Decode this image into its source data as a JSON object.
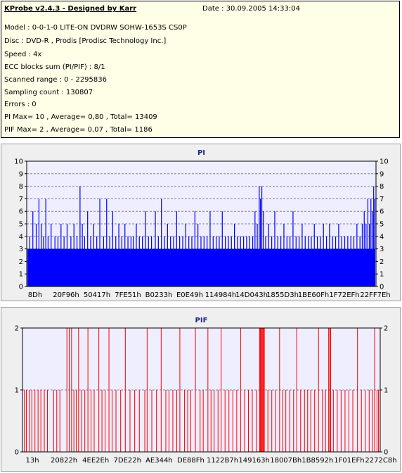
{
  "info": {
    "title": "KProbe v2.4.3 - Designed by Karr",
    "date": "Date : 30.09.2005 14:33:04",
    "lines": [
      "Model : 0-0-1-0 LITE-ON DVDRW SOHW-1653S CS0P",
      "Disc : DVD-R , Prodis [Prodisc Technology Inc.]",
      "Speed : 4x",
      "ECC blocks sum (PI/PIF) : 8/1",
      "Scanned range : 0 - 2295836",
      "Sampling count : 130807",
      "Errors : 0",
      "PI Max= 10 , Average= 0,80 , Total= 13409",
      "PIF Max= 2 , Average= 0,07 , Total= 1186"
    ]
  },
  "chart_data": [
    {
      "type": "bar",
      "title": "PI",
      "color": "#0000ff",
      "ylim": [
        0,
        10
      ],
      "yticks": [
        0,
        1,
        2,
        3,
        4,
        5,
        6,
        7,
        8,
        9,
        10
      ],
      "xlim": [
        0,
        2295836
      ],
      "xticks": [
        "8Dh",
        "20F96h",
        "50417h",
        "7FE51h",
        "B0233h",
        "E0E49h",
        "114984h",
        "14D043h",
        "1855D3h",
        "1BE60Fh",
        "1F72EFh",
        "22FF7Eh"
      ],
      "grid": true,
      "baseline": 3,
      "spikes": [
        {
          "x": 20000,
          "y": 4
        },
        {
          "x": 40000,
          "y": 6
        },
        {
          "x": 62000,
          "y": 5
        },
        {
          "x": 80000,
          "y": 7
        },
        {
          "x": 95000,
          "y": 5
        },
        {
          "x": 110000,
          "y": 4
        },
        {
          "x": 125000,
          "y": 7
        },
        {
          "x": 140000,
          "y": 4
        },
        {
          "x": 160000,
          "y": 5
        },
        {
          "x": 185000,
          "y": 4
        },
        {
          "x": 205000,
          "y": 4
        },
        {
          "x": 225000,
          "y": 5
        },
        {
          "x": 245000,
          "y": 4
        },
        {
          "x": 265000,
          "y": 5
        },
        {
          "x": 290000,
          "y": 4
        },
        {
          "x": 310000,
          "y": 5
        },
        {
          "x": 330000,
          "y": 4
        },
        {
          "x": 350000,
          "y": 8
        },
        {
          "x": 365000,
          "y": 5
        },
        {
          "x": 380000,
          "y": 4
        },
        {
          "x": 400000,
          "y": 6
        },
        {
          "x": 420000,
          "y": 4
        },
        {
          "x": 440000,
          "y": 5
        },
        {
          "x": 460000,
          "y": 4
        },
        {
          "x": 480000,
          "y": 7
        },
        {
          "x": 505000,
          "y": 4
        },
        {
          "x": 525000,
          "y": 7
        },
        {
          "x": 545000,
          "y": 4
        },
        {
          "x": 565000,
          "y": 6
        },
        {
          "x": 585000,
          "y": 4
        },
        {
          "x": 605000,
          "y": 5
        },
        {
          "x": 625000,
          "y": 4
        },
        {
          "x": 645000,
          "y": 5
        },
        {
          "x": 665000,
          "y": 4
        },
        {
          "x": 685000,
          "y": 4
        },
        {
          "x": 700000,
          "y": 4
        },
        {
          "x": 720000,
          "y": 5
        },
        {
          "x": 740000,
          "y": 4
        },
        {
          "x": 760000,
          "y": 4
        },
        {
          "x": 780000,
          "y": 6
        },
        {
          "x": 800000,
          "y": 4
        },
        {
          "x": 820000,
          "y": 4
        },
        {
          "x": 845000,
          "y": 6
        },
        {
          "x": 865000,
          "y": 4
        },
        {
          "x": 885000,
          "y": 7
        },
        {
          "x": 905000,
          "y": 4
        },
        {
          "x": 925000,
          "y": 5
        },
        {
          "x": 945000,
          "y": 4
        },
        {
          "x": 965000,
          "y": 4
        },
        {
          "x": 985000,
          "y": 6
        },
        {
          "x": 1005000,
          "y": 4
        },
        {
          "x": 1025000,
          "y": 4
        },
        {
          "x": 1045000,
          "y": 5
        },
        {
          "x": 1065000,
          "y": 4
        },
        {
          "x": 1085000,
          "y": 4
        },
        {
          "x": 1105000,
          "y": 6
        },
        {
          "x": 1125000,
          "y": 5
        },
        {
          "x": 1145000,
          "y": 4
        },
        {
          "x": 1165000,
          "y": 4
        },
        {
          "x": 1185000,
          "y": 4
        },
        {
          "x": 1205000,
          "y": 6
        },
        {
          "x": 1225000,
          "y": 4
        },
        {
          "x": 1245000,
          "y": 4
        },
        {
          "x": 1265000,
          "y": 4
        },
        {
          "x": 1285000,
          "y": 6
        },
        {
          "x": 1305000,
          "y": 4
        },
        {
          "x": 1325000,
          "y": 4
        },
        {
          "x": 1345000,
          "y": 4
        },
        {
          "x": 1365000,
          "y": 5
        },
        {
          "x": 1385000,
          "y": 4
        },
        {
          "x": 1405000,
          "y": 4
        },
        {
          "x": 1425000,
          "y": 4
        },
        {
          "x": 1445000,
          "y": 4
        },
        {
          "x": 1465000,
          "y": 4
        },
        {
          "x": 1485000,
          "y": 4
        },
        {
          "x": 1500000,
          "y": 6
        },
        {
          "x": 1515000,
          "y": 5
        },
        {
          "x": 1528000,
          "y": 8
        },
        {
          "x": 1536000,
          "y": 7
        },
        {
          "x": 1545000,
          "y": 8
        },
        {
          "x": 1555000,
          "y": 6
        },
        {
          "x": 1570000,
          "y": 4
        },
        {
          "x": 1590000,
          "y": 5
        },
        {
          "x": 1610000,
          "y": 4
        },
        {
          "x": 1630000,
          "y": 6
        },
        {
          "x": 1650000,
          "y": 4
        },
        {
          "x": 1670000,
          "y": 4
        },
        {
          "x": 1690000,
          "y": 5
        },
        {
          "x": 1710000,
          "y": 4
        },
        {
          "x": 1730000,
          "y": 4
        },
        {
          "x": 1750000,
          "y": 6
        },
        {
          "x": 1770000,
          "y": 4
        },
        {
          "x": 1790000,
          "y": 4
        },
        {
          "x": 1810000,
          "y": 5
        },
        {
          "x": 1830000,
          "y": 4
        },
        {
          "x": 1850000,
          "y": 4
        },
        {
          "x": 1870000,
          "y": 4
        },
        {
          "x": 1890000,
          "y": 5
        },
        {
          "x": 1910000,
          "y": 4
        },
        {
          "x": 1930000,
          "y": 4
        },
        {
          "x": 1950000,
          "y": 5
        },
        {
          "x": 1970000,
          "y": 4
        },
        {
          "x": 1990000,
          "y": 5
        },
        {
          "x": 2010000,
          "y": 4
        },
        {
          "x": 2030000,
          "y": 4
        },
        {
          "x": 2050000,
          "y": 5
        },
        {
          "x": 2070000,
          "y": 4
        },
        {
          "x": 2090000,
          "y": 4
        },
        {
          "x": 2110000,
          "y": 4
        },
        {
          "x": 2130000,
          "y": 4
        },
        {
          "x": 2150000,
          "y": 4
        },
        {
          "x": 2170000,
          "y": 5
        },
        {
          "x": 2190000,
          "y": 4
        },
        {
          "x": 2205000,
          "y": 5
        },
        {
          "x": 2218000,
          "y": 6
        },
        {
          "x": 2230000,
          "y": 5
        },
        {
          "x": 2242000,
          "y": 7
        },
        {
          "x": 2252000,
          "y": 5
        },
        {
          "x": 2262000,
          "y": 7
        },
        {
          "x": 2272000,
          "y": 6
        },
        {
          "x": 2280000,
          "y": 8
        },
        {
          "x": 2288000,
          "y": 7
        }
      ]
    },
    {
      "type": "bar",
      "title": "PIF",
      "color": "#ff0000",
      "ylim": [
        0,
        2
      ],
      "yticks": [
        0,
        1,
        2
      ],
      "xlim": [
        0,
        2295836
      ],
      "xticks": [
        "13h",
        "20822h",
        "4EE2Eh",
        "7DE22h",
        "AE344h",
        "DE88Fh",
        "1122B7h",
        "149163h",
        "18007Bh",
        "1B8592h",
        "1F01EFh",
        "2272C8h"
      ],
      "grid": true,
      "spikes": [
        {
          "x": 12000,
          "y": 1
        },
        {
          "x": 25000,
          "y": 1
        },
        {
          "x": 45000,
          "y": 1
        },
        {
          "x": 60000,
          "y": 1
        },
        {
          "x": 80000,
          "y": 1
        },
        {
          "x": 100000,
          "y": 1
        },
        {
          "x": 118000,
          "y": 1
        },
        {
          "x": 140000,
          "y": 1
        },
        {
          "x": 160000,
          "y": 1
        },
        {
          "x": 200000,
          "y": 1
        },
        {
          "x": 220000,
          "y": 1
        },
        {
          "x": 240000,
          "y": 1
        },
        {
          "x": 285000,
          "y": 2
        },
        {
          "x": 300000,
          "y": 2
        },
        {
          "x": 315000,
          "y": 2
        },
        {
          "x": 330000,
          "y": 1
        },
        {
          "x": 345000,
          "y": 1
        },
        {
          "x": 360000,
          "y": 2
        },
        {
          "x": 380000,
          "y": 1
        },
        {
          "x": 400000,
          "y": 1
        },
        {
          "x": 420000,
          "y": 2
        },
        {
          "x": 440000,
          "y": 1
        },
        {
          "x": 460000,
          "y": 1
        },
        {
          "x": 490000,
          "y": 2
        },
        {
          "x": 510000,
          "y": 1
        },
        {
          "x": 530000,
          "y": 1
        },
        {
          "x": 555000,
          "y": 2
        },
        {
          "x": 575000,
          "y": 1
        },
        {
          "x": 600000,
          "y": 1
        },
        {
          "x": 630000,
          "y": 1
        },
        {
          "x": 660000,
          "y": 2
        },
        {
          "x": 690000,
          "y": 1
        },
        {
          "x": 720000,
          "y": 1
        },
        {
          "x": 750000,
          "y": 1
        },
        {
          "x": 785000,
          "y": 1
        },
        {
          "x": 800000,
          "y": 2
        },
        {
          "x": 830000,
          "y": 1
        },
        {
          "x": 860000,
          "y": 1
        },
        {
          "x": 890000,
          "y": 2
        },
        {
          "x": 920000,
          "y": 1
        },
        {
          "x": 940000,
          "y": 1
        },
        {
          "x": 965000,
          "y": 1
        },
        {
          "x": 990000,
          "y": 1
        },
        {
          "x": 1010000,
          "y": 2
        },
        {
          "x": 1040000,
          "y": 1
        },
        {
          "x": 1060000,
          "y": 1
        },
        {
          "x": 1080000,
          "y": 1
        },
        {
          "x": 1110000,
          "y": 2
        },
        {
          "x": 1140000,
          "y": 1
        },
        {
          "x": 1160000,
          "y": 1
        },
        {
          "x": 1190000,
          "y": 2
        },
        {
          "x": 1210000,
          "y": 1
        },
        {
          "x": 1230000,
          "y": 1
        },
        {
          "x": 1255000,
          "y": 1
        },
        {
          "x": 1275000,
          "y": 2
        },
        {
          "x": 1300000,
          "y": 1
        },
        {
          "x": 1325000,
          "y": 1
        },
        {
          "x": 1350000,
          "y": 1
        },
        {
          "x": 1375000,
          "y": 1
        },
        {
          "x": 1400000,
          "y": 2
        },
        {
          "x": 1425000,
          "y": 1
        },
        {
          "x": 1450000,
          "y": 1
        },
        {
          "x": 1475000,
          "y": 1
        },
        {
          "x": 1500000,
          "y": 1
        },
        {
          "x": 1522000,
          "y": 2
        },
        {
          "x": 1527000,
          "y": 2
        },
        {
          "x": 1532000,
          "y": 2
        },
        {
          "x": 1537000,
          "y": 2
        },
        {
          "x": 1542000,
          "y": 2
        },
        {
          "x": 1547000,
          "y": 2
        },
        {
          "x": 1552000,
          "y": 2
        },
        {
          "x": 1575000,
          "y": 1
        },
        {
          "x": 1600000,
          "y": 1
        },
        {
          "x": 1625000,
          "y": 1
        },
        {
          "x": 1650000,
          "y": 2
        },
        {
          "x": 1670000,
          "y": 1
        },
        {
          "x": 1690000,
          "y": 1
        },
        {
          "x": 1715000,
          "y": 1
        },
        {
          "x": 1740000,
          "y": 1
        },
        {
          "x": 1760000,
          "y": 2
        },
        {
          "x": 1785000,
          "y": 1
        },
        {
          "x": 1810000,
          "y": 1
        },
        {
          "x": 1830000,
          "y": 1
        },
        {
          "x": 1850000,
          "y": 1
        },
        {
          "x": 1875000,
          "y": 1
        },
        {
          "x": 1900000,
          "y": 2
        },
        {
          "x": 1925000,
          "y": 1
        },
        {
          "x": 1945000,
          "y": 1
        },
        {
          "x": 1965000,
          "y": 2
        },
        {
          "x": 1972000,
          "y": 2
        },
        {
          "x": 1978000,
          "y": 2
        },
        {
          "x": 1995000,
          "y": 1
        },
        {
          "x": 2020000,
          "y": 1
        },
        {
          "x": 2045000,
          "y": 1
        },
        {
          "x": 2070000,
          "y": 1
        },
        {
          "x": 2095000,
          "y": 1
        },
        {
          "x": 2120000,
          "y": 1
        },
        {
          "x": 2150000,
          "y": 2
        },
        {
          "x": 2175000,
          "y": 1
        },
        {
          "x": 2200000,
          "y": 1
        },
        {
          "x": 2225000,
          "y": 1
        },
        {
          "x": 2245000,
          "y": 1
        },
        {
          "x": 2260000,
          "y": 2
        },
        {
          "x": 2275000,
          "y": 1
        },
        {
          "x": 2285000,
          "y": 1
        }
      ]
    }
  ]
}
